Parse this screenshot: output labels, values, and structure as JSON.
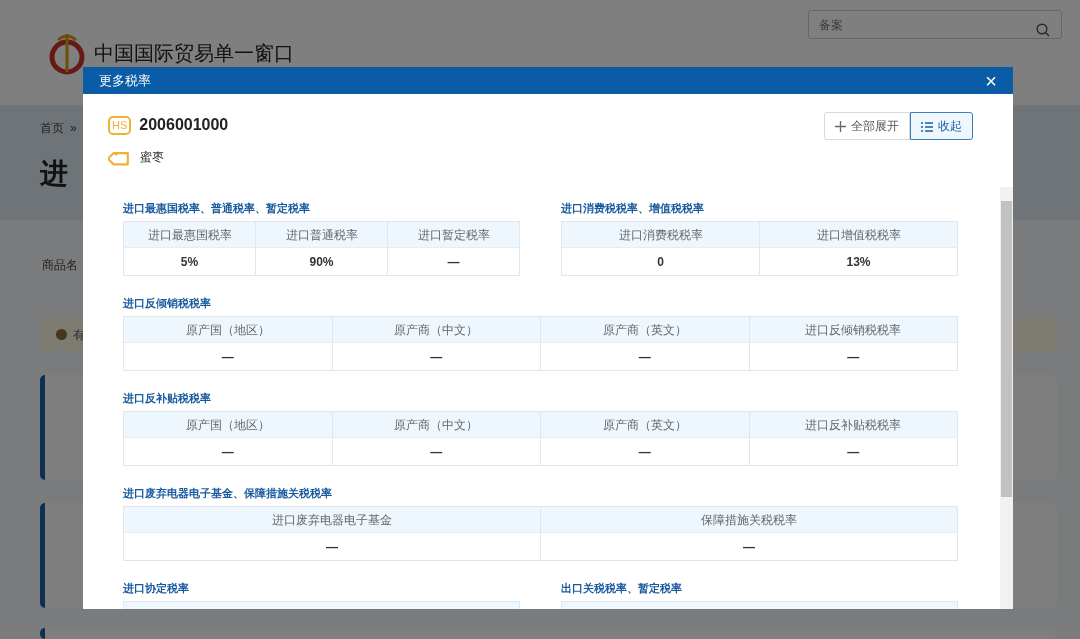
{
  "background": {
    "search": {
      "placeholder": "备案"
    },
    "logo": "中国国际贸易单一窗口",
    "breadcrumb": [
      "首页",
      "»"
    ],
    "page_title": "进",
    "field_label": "商品名",
    "alert": "有"
  },
  "modal": {
    "title": "更多税率",
    "close": "×",
    "hs_badge": "HS",
    "hs_code": "2006001000",
    "product": "蜜枣",
    "buttons": [
      {
        "label": "全部展开",
        "kind": "expand",
        "selected": false
      },
      {
        "label": "收起",
        "kind": "collapse",
        "selected": true
      }
    ],
    "sections": [
      {
        "title": "进口最惠国税率、普通税率、暂定税率",
        "kind": "half",
        "columns": [
          "进口最惠国税率",
          "进口普通税率",
          "进口暂定税率"
        ],
        "rows": [
          [
            "5%",
            "90%",
            "—"
          ]
        ]
      },
      {
        "title": "进口消费税税率、增值税税率",
        "kind": "half",
        "columns": [
          "进口消费税税率",
          "进口增值税税率"
        ],
        "rows": [
          [
            "0",
            "13%"
          ]
        ]
      },
      {
        "title": "进口反倾销税税率",
        "kind": "full",
        "columns": [
          "原产国（地区）",
          "原产商（中文）",
          "原产商（英文）",
          "进口反倾销税税率"
        ],
        "rows": [
          [
            "—",
            "—",
            "—",
            "—"
          ]
        ]
      },
      {
        "title": "进口反补贴税税率",
        "kind": "full",
        "columns": [
          "原产国（地区）",
          "原产商（中文）",
          "原产商（英文）",
          "进口反补贴税税率"
        ],
        "rows": [
          [
            "—",
            "—",
            "—",
            "—"
          ]
        ]
      },
      {
        "title": "进口废弃电器电子基金、保障措施关税税率",
        "kind": "full",
        "columns": [
          "进口废弃电器电子基金",
          "保障措施关税税率"
        ],
        "rows": [
          [
            "—",
            "—"
          ]
        ]
      },
      {
        "title": "进口协定税率",
        "kind": "half"
      },
      {
        "title": "出口关税税率、暂定税率",
        "kind": "half"
      }
    ]
  }
}
